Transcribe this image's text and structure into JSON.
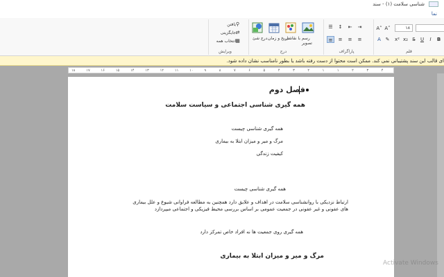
{
  "window": {
    "title": "شناسی سلامت (۱) - سند"
  },
  "tabs": {
    "active": "نما"
  },
  "ribbon": {
    "groups": {
      "edit": "ویرایش",
      "insert": "درج",
      "paragraph": "پاراگراف",
      "font": "قلم"
    },
    "edit": {
      "find": "یافتن",
      "replace": "جایگزینی",
      "select_all": "انتخاب همه"
    },
    "insert": {
      "object": "درج شئ",
      "datetime": "تاریخ و زمان",
      "paint": "رسم با نقاشی",
      "picture": "تصویر"
    },
    "font": {
      "size": "۱۸"
    }
  },
  "infobar": {
    "message": "ای قالب این سند پشتیبانی نمی کند. ممکن است محتوا از دست رفته باشد یا بطور نامناسب نشان داده شود."
  },
  "ruler": {
    "ticks": [
      "۱۸",
      "۱۷",
      "۱۶",
      "۱۵",
      "۱۴",
      "۱۳",
      "۱۲",
      "۱۱",
      "۱۰",
      "۹",
      "۸",
      "۷",
      "۶",
      "۵",
      "۴",
      "۳",
      "۲",
      "۱",
      "۱",
      "۲",
      "۳",
      "۴"
    ]
  },
  "document": {
    "heading1": "فصل دوم",
    "heading2": "همه گیری شناسی اجتماعی و سیاست سلامت",
    "toc1": "همه گیری شناسی چیست",
    "toc2": "مرگ و میر و میزان ابتلا به بیماری",
    "toc3": "کیفیت زندگی",
    "section_title": "همه گیری شناسی چیست",
    "para_line1": "ارتباط نزدیکی با روانشناسی سلامت در اهداف و علایق دارد همچنین به مطالعه فراوانی  شیوع و علل بیماری",
    "para_line2": "های عفونی و غیر عفونی در جمعیت عمومی بر اساس بررسی محیط فیزیکی و اجتماعی میپردازد",
    "para2": "همه گیری روی جمعیت ها نه افراد خاص تمرکز دارد",
    "heading3": "مرگ و میر و میزان ابتلا به بیماری"
  },
  "watermark": "Activate Windows"
}
